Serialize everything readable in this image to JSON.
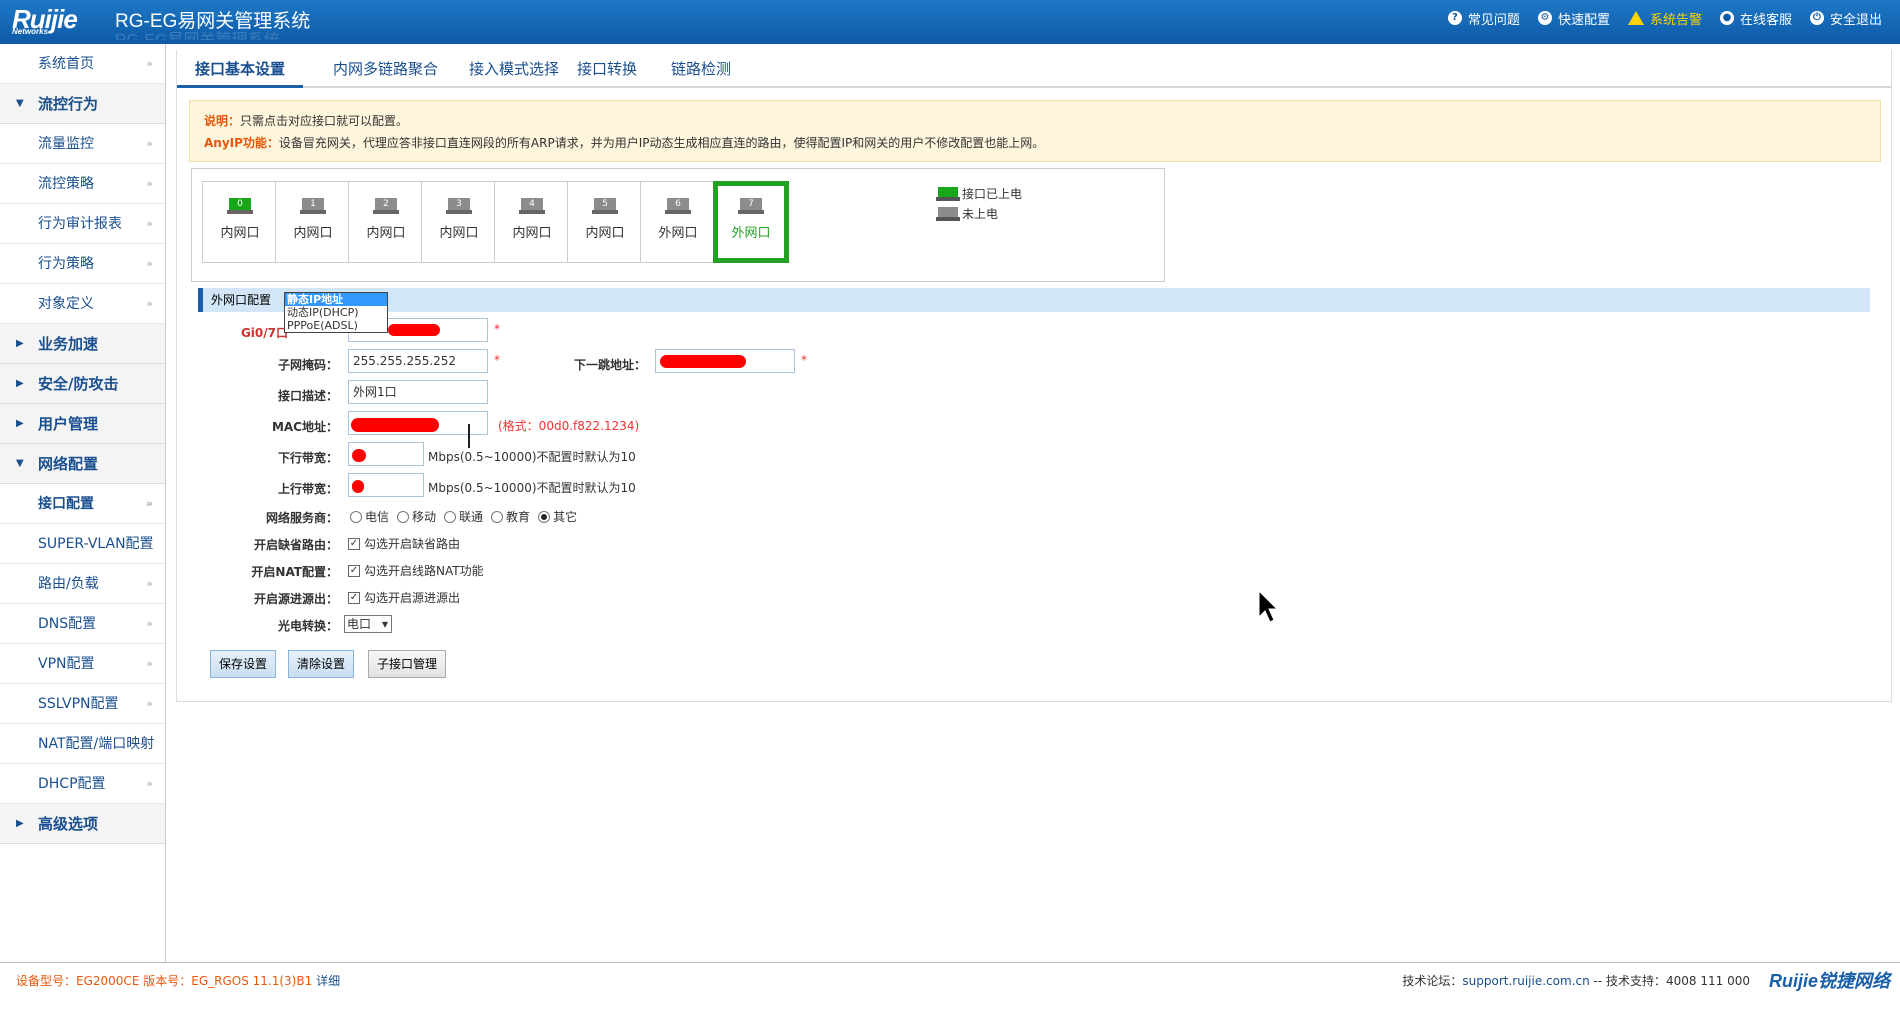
{
  "header": {
    "logo": "Ruijie",
    "logo_sub": "Networks",
    "title": "RG-EG易网关管理系统",
    "links": [
      {
        "label": "常见问题",
        "icon": "question-icon"
      },
      {
        "label": "快速配置",
        "icon": "gear-icon"
      },
      {
        "label": "系统告警",
        "icon": "warning-icon"
      },
      {
        "label": "在线客服",
        "icon": "user-icon"
      },
      {
        "label": "安全退出",
        "icon": "power-icon"
      }
    ]
  },
  "sidebar": {
    "items": [
      {
        "label": "系统首页",
        "type": "item"
      },
      {
        "label": "流控行为",
        "type": "group",
        "expanded": true
      },
      {
        "label": "流量监控",
        "type": "item"
      },
      {
        "label": "流控策略",
        "type": "item"
      },
      {
        "label": "行为审计报表",
        "type": "item"
      },
      {
        "label": "行为策略",
        "type": "item"
      },
      {
        "label": "对象定义",
        "type": "item"
      },
      {
        "label": "业务加速",
        "type": "group",
        "expanded": false
      },
      {
        "label": "安全/防攻击",
        "type": "group",
        "expanded": false
      },
      {
        "label": "用户管理",
        "type": "group",
        "expanded": false
      },
      {
        "label": "网络配置",
        "type": "group",
        "expanded": true
      },
      {
        "label": "接口配置",
        "type": "item",
        "active": true
      },
      {
        "label": "SUPER-VLAN配置",
        "type": "item"
      },
      {
        "label": "路由/负载",
        "type": "item"
      },
      {
        "label": "DNS配置",
        "type": "item"
      },
      {
        "label": "VPN配置",
        "type": "item"
      },
      {
        "label": "SSLVPN配置",
        "type": "item"
      },
      {
        "label": "NAT配置/端口映射",
        "type": "item"
      },
      {
        "label": "DHCP配置",
        "type": "item"
      },
      {
        "label": "高级选项",
        "type": "group",
        "expanded": false
      }
    ],
    "arrow": "»"
  },
  "tabs": [
    "接口基本设置",
    "内网多链路聚合",
    "接入模式选择",
    "接口转换",
    "链路检测"
  ],
  "notice": {
    "label1": "说明：",
    "text1": "只需点击对应接口就可以配置。",
    "label2": "AnyIP功能：",
    "text2": "设备冒充网关，代理应答非接口直连网段的所有ARP请求，并为用户IP动态生成相应直连的路由，使得配置IP和网关的用户不修改配置也能上网。"
  },
  "ports": [
    {
      "num": "0",
      "label": "内网口",
      "powered": true
    },
    {
      "num": "1",
      "label": "内网口",
      "powered": false
    },
    {
      "num": "2",
      "label": "内网口",
      "powered": false
    },
    {
      "num": "3",
      "label": "内网口",
      "powered": false
    },
    {
      "num": "4",
      "label": "内网口",
      "powered": false
    },
    {
      "num": "5",
      "label": "内网口",
      "powered": false
    },
    {
      "num": "6",
      "label": "外网口",
      "powered": false
    },
    {
      "num": "7",
      "label": "外网口",
      "powered": false,
      "selected": true
    }
  ],
  "legend": {
    "on": "接口已上电",
    "off": "未上电"
  },
  "form": {
    "section_title": "外网口配置",
    "mode_options": [
      "静态IP地址",
      "动态IP(DHCP)",
      "PPPoE(ADSL)"
    ],
    "mode_selected": "静态IP地址",
    "ip_label": "Gi0/7口",
    "mask_label": "子网掩码：",
    "mask_value": "255.255.255.252",
    "nexthop_label": "下一跳地址：",
    "desc_label": "接口描述：",
    "desc_value": "外网1口",
    "mac_label": "MAC地址：",
    "mac_hint": "(格式：00d0.f822.1234)",
    "down_label": "下行带宽：",
    "down_hint": "Mbps(0.5~10000)不配置时默认为10",
    "up_label": "上行带宽：",
    "up_hint": "Mbps(0.5~10000)不配置时默认为10",
    "isp_label": "网络服务商：",
    "isp_options": [
      "电信",
      "移动",
      "联通",
      "教育",
      "其它"
    ],
    "isp_selected": "其它",
    "default_route_label": "开启缺省路由：",
    "default_route_text": "勾选开启缺省路由",
    "nat_label": "开启NAT配置：",
    "nat_text": "勾选开启线路NAT功能",
    "src_label": "开启源进源出：",
    "src_text": "勾选开启源进源出",
    "conv_label": "光电转换：",
    "conv_value": "电口",
    "required": "*",
    "buttons": {
      "save": "保存设置",
      "clear": "清除设置",
      "sub": "子接口管理"
    }
  },
  "footer": {
    "device_label": "设备型号：",
    "device_value": "EG2000CE",
    "version_label": "版本号：",
    "version_value": "EG_RGOS 11.1(3)B1",
    "detail": "详细",
    "forum_label": "技术论坛：",
    "forum_link": "support.ruijie.com.cn",
    "support_label": "-- 技术支持：",
    "support_phone": "4008 111 000",
    "logo": "Ruijie锐捷网络"
  }
}
